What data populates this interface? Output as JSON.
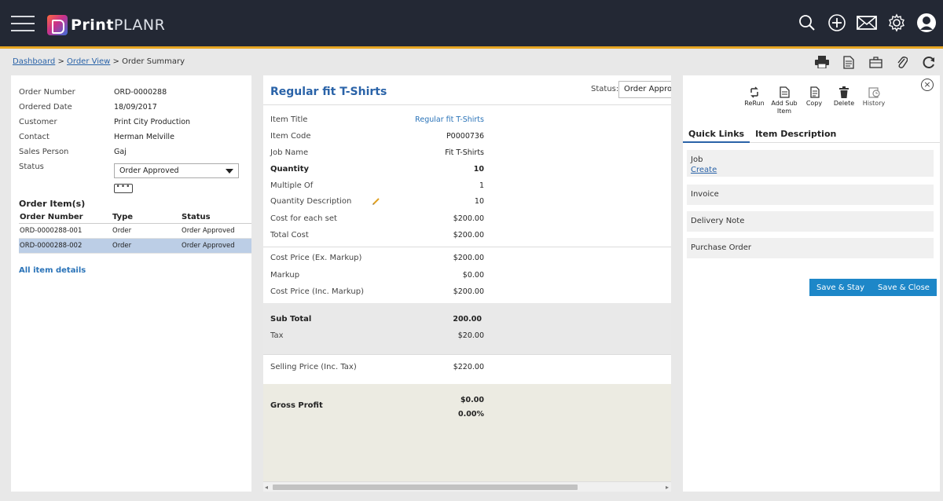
{
  "app": {
    "logo_bold": "Print",
    "logo_light": "PLANR"
  },
  "breadcrumb": {
    "items": [
      "Dashboard",
      "Order View",
      "Order Summary"
    ],
    "separator": ">"
  },
  "order": {
    "labels": {
      "order_number": "Order Number",
      "ordered_date": "Ordered Date",
      "customer": "Customer",
      "contact": "Contact",
      "sales_person": "Sales Person",
      "status": "Status"
    },
    "values": {
      "order_number": "ORD-0000288",
      "ordered_date": "18/09/2017",
      "customer": "Print City Production",
      "contact": "Herman Melville",
      "sales_person": "Gaj",
      "status": "Order Approved"
    },
    "more_label": "•••"
  },
  "order_items": {
    "title": "Order Item(s)",
    "headers": [
      "Order Number",
      "Type",
      "Status"
    ],
    "rows": [
      {
        "number": "ORD-0000288-001",
        "type": "Order",
        "status": "Order Approved",
        "selected": false
      },
      {
        "number": "ORD-0000288-002",
        "type": "Order",
        "status": "Order Approved",
        "selected": true
      }
    ],
    "all_details": "All item details"
  },
  "item": {
    "title": "Regular fit T-Shirts",
    "status_label": "Status:",
    "status_value": "Order Approved",
    "rows": [
      {
        "label": "Item Title",
        "value": "Regular fit T-Shirts"
      },
      {
        "label": "Item Code",
        "value": "P0000736"
      },
      {
        "label": "Job Name",
        "value": "Fit T-Shirts"
      },
      {
        "label": "Quantity",
        "value": "10"
      },
      {
        "label": "Multiple Of",
        "value": "1"
      },
      {
        "label": "Quantity Description",
        "value": "10"
      },
      {
        "label": "Cost for each set",
        "value": "$200.00"
      },
      {
        "label": "Total Cost",
        "value": "$200.00"
      },
      {
        "label": "Cost Price (Ex. Markup)",
        "value": "$200.00"
      },
      {
        "label": "Markup",
        "value": "$0.00"
      },
      {
        "label": "Cost Price (Inc. Markup)",
        "value": "$200.00"
      },
      {
        "label": "Sub Total",
        "value": "200.00"
      },
      {
        "label": "Tax",
        "value": "$20.00"
      },
      {
        "label": "Selling Price (Inc. Tax)",
        "value": "$220.00"
      },
      {
        "label": "Gross Profit",
        "value": "$0.00",
        "value2": "0.00%"
      }
    ]
  },
  "side": {
    "actions": [
      {
        "label": "ReRun",
        "icon": "rerun-icon"
      },
      {
        "label": "Add Sub Item",
        "icon": "add-sub-item-icon"
      },
      {
        "label": "Copy",
        "icon": "copy-icon"
      },
      {
        "label": "Delete",
        "icon": "delete-icon"
      },
      {
        "label": "History",
        "icon": "history-icon"
      }
    ],
    "tabs": [
      "Quick Links",
      "Item Description"
    ],
    "quick_links": {
      "job": "Job",
      "job_create": "Create",
      "invoice": "Invoice",
      "delivery_note": "Delivery Note",
      "purchase_order": "Purchase Order"
    },
    "save_stay": "Save & Stay",
    "save_close": "Save & Close"
  },
  "colors": {
    "topbar": "#232834",
    "accent_line": "#e7a623",
    "link": "#2a63a8",
    "button": "#1d87c8",
    "selected_row": "#bccee6"
  }
}
